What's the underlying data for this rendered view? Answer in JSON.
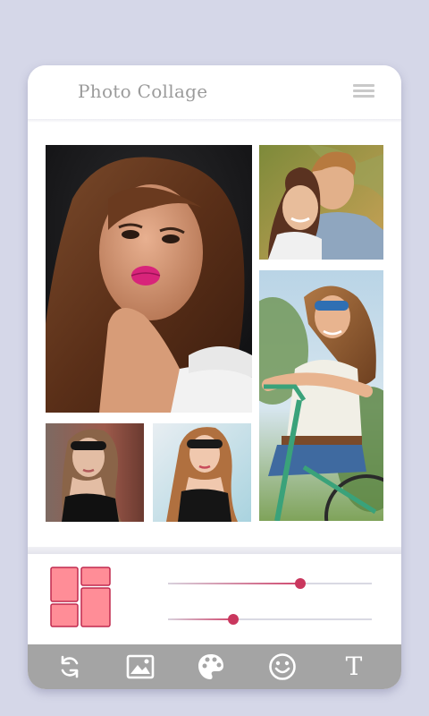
{
  "app": {
    "title": "Photo Collage"
  },
  "header": {
    "menu_icon": "hamburger-menu-icon"
  },
  "collage": {
    "photos": [
      {
        "name": "portrait-woman-red-lips",
        "description_icon": "photo"
      },
      {
        "name": "smiling-couple",
        "description_icon": "photo"
      },
      {
        "name": "woman-with-bicycle",
        "description_icon": "photo"
      },
      {
        "name": "woman-sunglasses-wall",
        "description_icon": "photo"
      },
      {
        "name": "woman-sunglasses-light-background",
        "description_icon": "photo"
      }
    ]
  },
  "controls": {
    "layout_icon": "collage-layout-icon",
    "slider_top_value": 0.65,
    "slider_bottom_value": 0.32
  },
  "toolbar": {
    "items": [
      {
        "name": "refresh-icon"
      },
      {
        "name": "image-icon"
      },
      {
        "name": "palette-icon"
      },
      {
        "name": "emoji-icon"
      },
      {
        "name": "text-tool",
        "label": "T"
      }
    ]
  },
  "colors": {
    "background": "#d5d7e8",
    "card": "#ffffff",
    "toolbar": "#a4a4a4",
    "accent": "#c9375e",
    "layout_fill": "#ff8d97",
    "layout_stroke": "#c02a4f"
  }
}
